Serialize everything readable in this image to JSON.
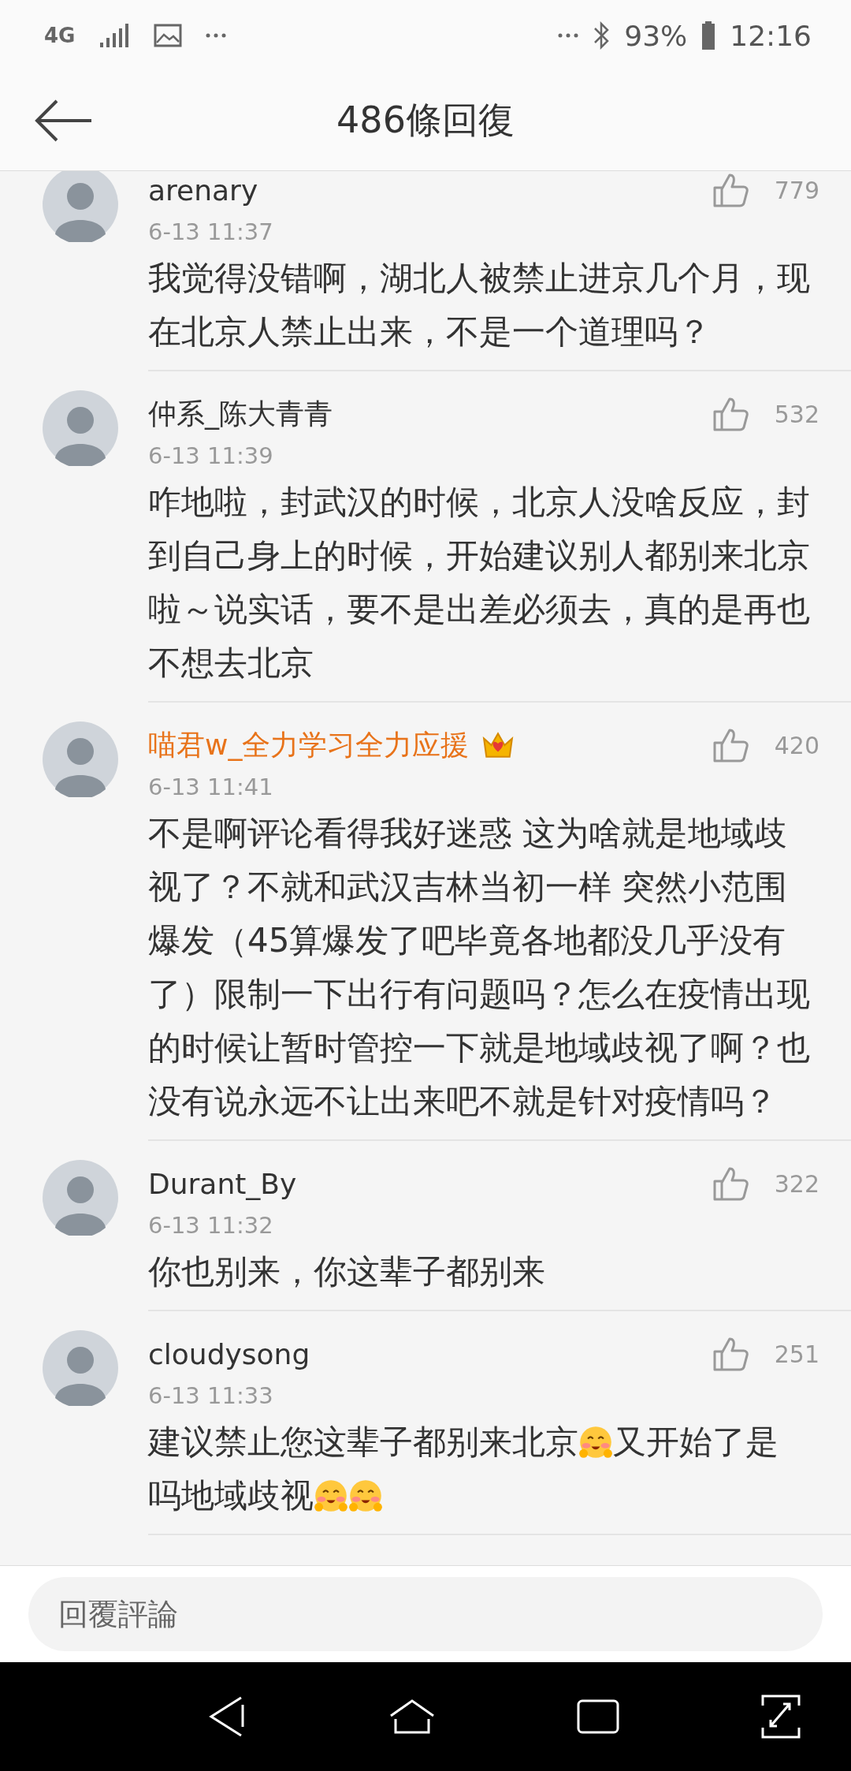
{
  "status_bar": {
    "network": "4G",
    "battery": "93%",
    "time": "12:16"
  },
  "header": {
    "title": "486條回復"
  },
  "comments": [
    {
      "name": "arenary",
      "vip": false,
      "time": "6-13 11:37",
      "likes": "779",
      "body": [
        {
          "kind": "text",
          "text": "我觉得没错啊，湖北人被禁止进京几个月，现在北京人禁止出来，不是一个道理吗？"
        }
      ]
    },
    {
      "name": "仲系_陈大青青",
      "vip": false,
      "time": "6-13 11:39",
      "likes": "532",
      "body": [
        {
          "kind": "text",
          "text": "咋地啦，封武汉的时候，北京人没啥反应，封到自己身上的时候，开始建议别人都别来北京啦～说实话，要不是出差必须去，真的是再也不想去北京"
        }
      ]
    },
    {
      "name": "喵君w_全力学习全力应援",
      "vip": true,
      "time": "6-13 11:41",
      "likes": "420",
      "body": [
        {
          "kind": "text",
          "text": "不是啊评论看得我好迷惑 这为啥就是地域歧视了？不就和武汉吉林当初一样 突然小范围爆发（45算爆发了吧毕竟各地都没几乎没有了）限制一下出行有问题吗？怎么在疫情出现的时候让暂时管控一下就是地域歧视了啊？也没有说永远不让出来吧不就是针对疫情吗？"
        }
      ]
    },
    {
      "name": "Durant_By",
      "vip": false,
      "time": "6-13 11:32",
      "likes": "322",
      "body": [
        {
          "kind": "text",
          "text": "你也别来，你这辈子都别来"
        }
      ]
    },
    {
      "name": "cloudysong",
      "vip": false,
      "time": "6-13 11:33",
      "likes": "251",
      "body": [
        {
          "kind": "text",
          "text": "建议禁止您这辈子都别来北京"
        },
        {
          "kind": "emoji"
        },
        {
          "kind": "text",
          "text": "又开始了是"
        },
        {
          "kind": "text",
          "text": "吗地域歧视"
        },
        {
          "kind": "emoji"
        },
        {
          "kind": "emoji"
        }
      ]
    }
  ],
  "reply_bar": {
    "placeholder": "回覆評論"
  }
}
